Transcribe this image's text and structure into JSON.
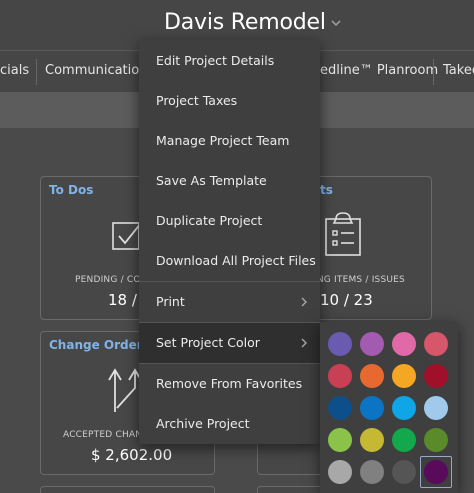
{
  "header": {
    "project_title": "Davis Remodel"
  },
  "nav": {
    "items": [
      "cials",
      "Communication",
      "edline™ Planroom",
      "Takeo"
    ]
  },
  "cards": {
    "todos": {
      "title": "To Dos",
      "caption": "PENDING / CO",
      "value": "18 /"
    },
    "issues": {
      "title": "ts",
      "caption": "ING ITEMS / ISSUES",
      "value": "10 / 23"
    },
    "change_orders": {
      "title": "Change Orders",
      "caption": "ACCEPTED CHAN",
      "value": "$ 2,602.00"
    }
  },
  "menu": {
    "items": [
      {
        "label": "Edit Project Details"
      },
      {
        "label": "Project Taxes"
      },
      {
        "label": "Manage Project Team"
      },
      {
        "label": "Save As Template"
      },
      {
        "label": "Duplicate Project"
      },
      {
        "label": "Download All Project Files"
      },
      {
        "label": "Print",
        "submenu": true
      },
      {
        "label": "Set Project Color",
        "submenu": true,
        "active": true
      },
      {
        "label": "Remove From Favorites"
      },
      {
        "label": "Archive Project"
      }
    ]
  },
  "color_palette": {
    "selected_index": 19,
    "colors": [
      "#6b5bb0",
      "#a25bb0",
      "#e06aa8",
      "#d8566a",
      "#c94055",
      "#e8692f",
      "#f5a623",
      "#a0102a",
      "#0d4f8b",
      "#0c74c4",
      "#0fa6e8",
      "#9fcaec",
      "#8bc34a",
      "#c5b934",
      "#12a84b",
      "#5a8a2a",
      "#a8a8a8",
      "#808080",
      "#555555",
      "#5a0a5a"
    ]
  }
}
